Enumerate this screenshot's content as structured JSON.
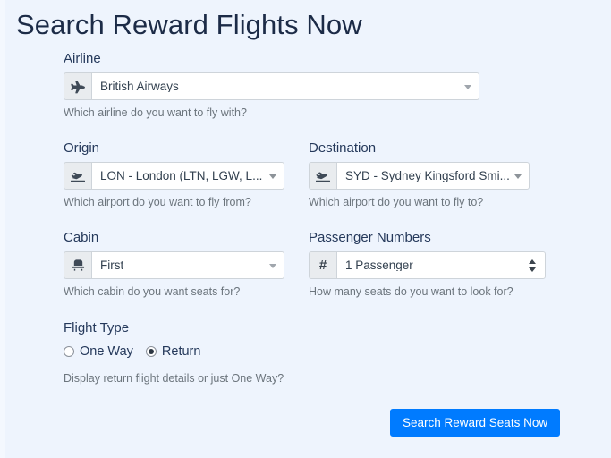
{
  "page": {
    "title": "Search Reward Flights Now",
    "background_color": "#eef4fd",
    "accent_color": "#007bff",
    "title_color": "#1c2b47",
    "help_text_color": "#6c757d"
  },
  "form": {
    "airline": {
      "label": "Airline",
      "icon": "plane-icon",
      "value": "British Airways",
      "help": "Which airline do you want to fly with?",
      "control_type": "select"
    },
    "origin": {
      "label": "Origin",
      "icon": "plane-departure-icon",
      "value": "LON - London (LTN, LGW, L...",
      "help": "Which airport do you want to fly from?",
      "control_type": "select"
    },
    "destination": {
      "label": "Destination",
      "icon": "plane-arrival-icon",
      "value": "SYD - Sydney Kingsford Smi...",
      "help": "Which airport do you want to fly to?",
      "control_type": "select"
    },
    "cabin": {
      "label": "Cabin",
      "icon": "seat-icon",
      "value": "First",
      "help": "Which cabin do you want seats for?",
      "control_type": "select"
    },
    "passengers": {
      "label": "Passenger Numbers",
      "icon": "hash-icon",
      "icon_glyph": "#",
      "value": "1 Passenger",
      "help": "How many seats do you want to look for?",
      "control_type": "native-select"
    },
    "flight_type": {
      "label": "Flight Type",
      "help": "Display return flight details or just One Way?",
      "options": [
        {
          "label": "One Way",
          "selected": false
        },
        {
          "label": "Return",
          "selected": true
        }
      ]
    }
  },
  "actions": {
    "submit_label": "Search Reward Seats Now"
  }
}
